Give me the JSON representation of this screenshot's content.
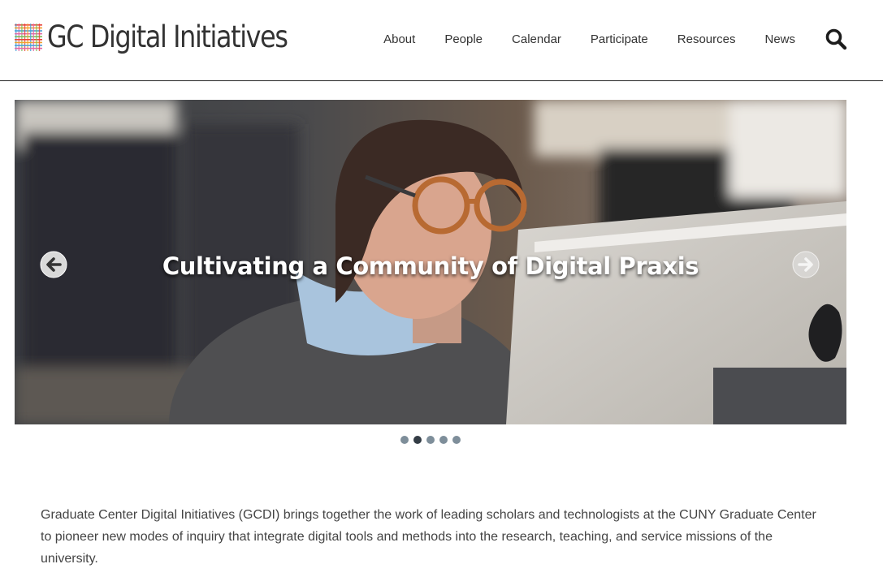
{
  "site": {
    "title": "GC Digital Initiatives"
  },
  "nav": {
    "items": [
      "About",
      "People",
      "Calendar",
      "Participate",
      "Resources",
      "News"
    ],
    "search_icon": "search-icon"
  },
  "hero": {
    "caption": "Cultivating a Community of Digital Praxis",
    "prev_icon": "arrow-left-circle-icon",
    "next_icon": "arrow-right-circle-icon",
    "slide_count": 5,
    "active_slide": 2
  },
  "intro": {
    "text": "Graduate Center Digital Initiatives (GCDI) brings together the work of leading scholars and technologists at the CUNY Graduate Center to pioneer new modes of inquiry that integrate digital tools and methods into the research, teaching, and service missions of the university."
  },
  "colors": {
    "logo_stripes": [
      "#e8443a",
      "#f2a22e",
      "#4aa0d8",
      "#e26aa6",
      "#7dbb5a"
    ],
    "dot": "#7e8e9a",
    "dot_active": "#333c45"
  }
}
